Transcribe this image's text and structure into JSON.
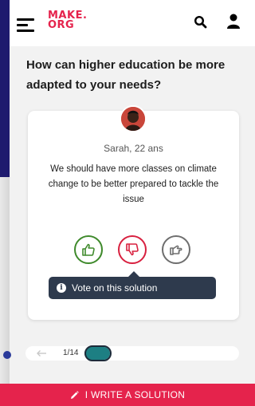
{
  "header": {
    "logo_line1": "MAKE.",
    "logo_line2": "ORG",
    "menu_icon": "hamburger-menu-icon",
    "search_icon": "search-icon",
    "account_icon": "user-icon",
    "brand_color": "#e5234c"
  },
  "question": "How can higher education be more adapted to your needs?",
  "proposal": {
    "author": "Sarah, 22 ans",
    "text": "We should have more classes on climate change to be better prepared to tackle the issue",
    "avatar_icon": "avatar"
  },
  "votes": {
    "agree_icon": "thumbs-up-icon",
    "disagree_icon": "thumbs-down-icon",
    "neutral_icon": "neutral-hand-icon",
    "agree_color": "#3f8a2c",
    "disagree_color": "#d8203f",
    "neutral_color": "#6e6e6e"
  },
  "tooltip": {
    "text": "Vote on this solution",
    "icon": "info-icon"
  },
  "pager": {
    "current": 1,
    "total": 14,
    "label": "1/14",
    "prev_icon": "arrow-left-icon",
    "progress_fraction": 0.07,
    "progress_color": "#1d7f83"
  },
  "cta": {
    "label": "I WRITE A SOLUTION",
    "icon": "pencil-icon"
  }
}
